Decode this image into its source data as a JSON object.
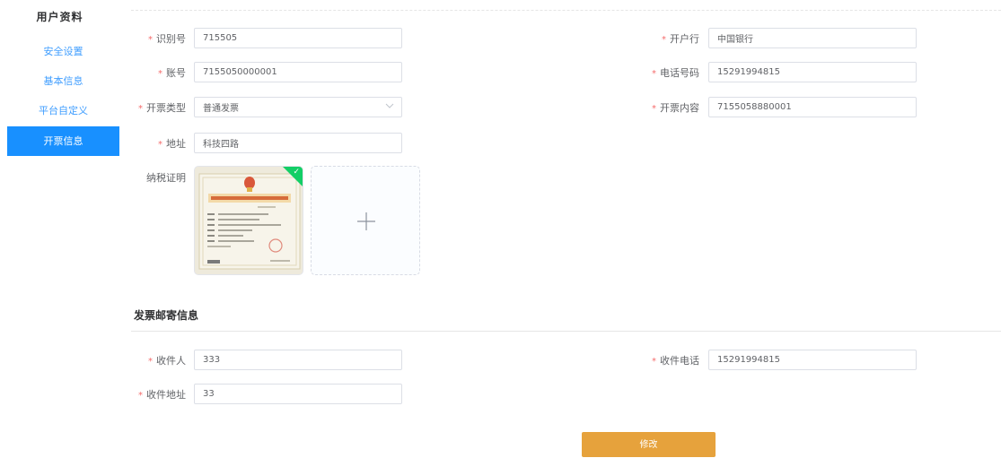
{
  "sidebar": {
    "title": "用户资料",
    "items": [
      {
        "label": "安全设置"
      },
      {
        "label": "基本信息"
      },
      {
        "label": "平台自定义"
      },
      {
        "label": "开票信息"
      }
    ]
  },
  "form": {
    "tax_id": {
      "label": "识别号",
      "value": "715505"
    },
    "bank": {
      "label": "开户行",
      "value": "中国银行"
    },
    "account": {
      "label": "账号",
      "value": "7155050000001"
    },
    "phone": {
      "label": "电话号码",
      "value": "15291994815"
    },
    "invoice_type": {
      "label": "开票类型",
      "value": "普通发票"
    },
    "invoice_content": {
      "label": "开票内容",
      "value": "7155058880001"
    },
    "address": {
      "label": "地址",
      "value": "科技四路"
    },
    "tax_certificate": {
      "label": "纳税证明"
    }
  },
  "mailing": {
    "title": "发票邮寄信息",
    "recipient": {
      "label": "收件人",
      "value": "333"
    },
    "recipient_phone": {
      "label": "收件电话",
      "value": "15291994815"
    },
    "recipient_address": {
      "label": "收件地址",
      "value": "33"
    }
  },
  "submit_label": "修改",
  "colors": {
    "accent": "#1890ff",
    "submit": "#e6a23c",
    "required": "#f56c6c",
    "upload_success": "#13ce66"
  }
}
